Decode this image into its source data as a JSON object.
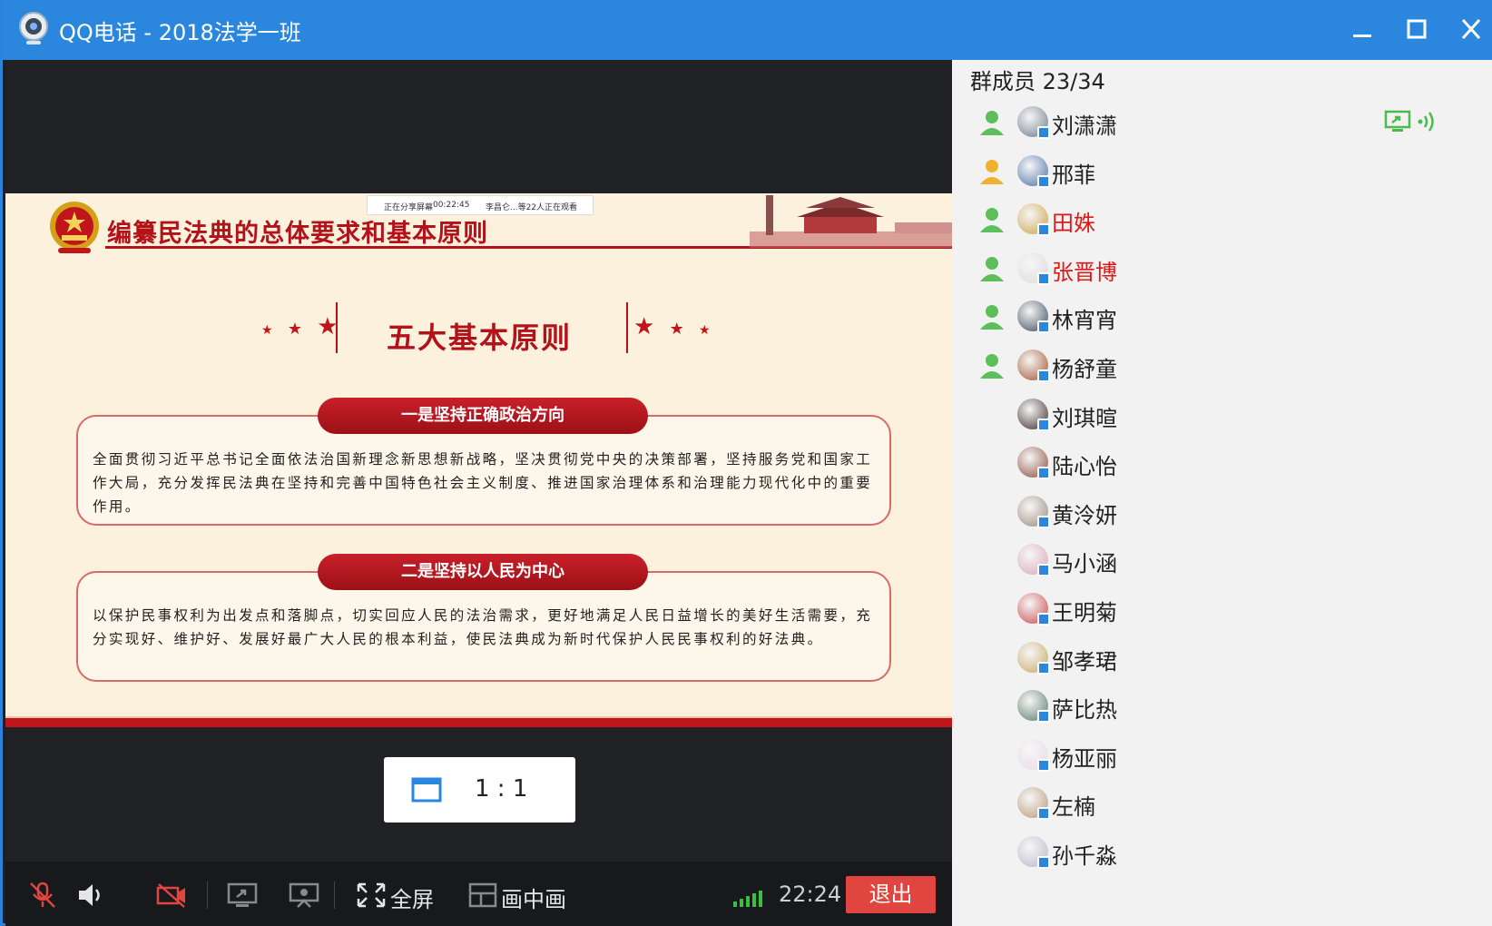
{
  "window": {
    "title": "QQ电话 - 2018法学一班",
    "icons": {
      "app": "qq-webcam-icon",
      "minimize": "minimize-icon",
      "maximize": "maximize-icon",
      "close": "close-icon"
    }
  },
  "share_banner": {
    "status": "正在分享屏幕",
    "timer": "00:22:45",
    "viewers": "李昌仑...等22人正在观看"
  },
  "slide": {
    "header_title": "编纂民法典的总体要求和基本原则",
    "section_title": "五大基本原则",
    "principles": [
      {
        "title": "一是坚持正确政治方向",
        "body": "全面贯彻习近平总书记全面依法治国新理念新思想新战略，坚决贯彻党中央的决策部署，坚持服务党和国家工作大局，充分发挥民法典在坚持和完善中国特色社会主义制度、推进国家治理体系和治理能力现代化中的重要作用。"
      },
      {
        "title": "二是坚持以人民为中心",
        "body": "以保护民事权利为出发点和落脚点，切实回应人民的法治需求，更好地满足人民日益增长的美好生活需要，充分实现好、维护好、发展好最广大人民的根本利益，使民法典成为新时代保护人民民事权利的好法典。"
      }
    ]
  },
  "view_ratio": {
    "label": "1 : 1",
    "icon": "window-icon"
  },
  "toolbar": {
    "mic_icon": "mic-muted-icon",
    "speaker_icon": "speaker-icon",
    "camera_icon": "camera-off-icon",
    "share_screen_icon": "share-screen-icon",
    "present_icon": "present-icon",
    "fullscreen_label": "全屏",
    "fullscreen_icon": "fullscreen-icon",
    "pip_label": "画中画",
    "pip_icon": "picture-in-picture-icon",
    "signal_icon": "signal-icon",
    "time": "22:24",
    "exit_label": "退出",
    "colors": {
      "exit": "#e0453f",
      "signal": "#3cbf3c"
    }
  },
  "members": {
    "header": "群成员 23/34",
    "list": [
      {
        "name": "刘潇潇",
        "in_call": true,
        "highlight": false,
        "sharing": true,
        "speaking": true
      },
      {
        "name": "邢菲",
        "in_call": true,
        "highlight": false,
        "sharing": false,
        "speaking": false
      },
      {
        "name": "田姝",
        "in_call": true,
        "highlight": true,
        "sharing": false,
        "speaking": false
      },
      {
        "name": "张晋博",
        "in_call": true,
        "highlight": true,
        "sharing": false,
        "speaking": false
      },
      {
        "name": "林宵宵",
        "in_call": true,
        "highlight": false,
        "sharing": false,
        "speaking": false
      },
      {
        "name": "杨舒童",
        "in_call": true,
        "highlight": false,
        "sharing": false,
        "speaking": false
      },
      {
        "name": "刘琪暄",
        "in_call": false,
        "highlight": false,
        "sharing": false,
        "speaking": false
      },
      {
        "name": "陆心怡",
        "in_call": false,
        "highlight": false,
        "sharing": false,
        "speaking": false
      },
      {
        "name": "黄泠妍",
        "in_call": false,
        "highlight": false,
        "sharing": false,
        "speaking": false
      },
      {
        "name": "马小涵",
        "in_call": false,
        "highlight": false,
        "sharing": false,
        "speaking": false
      },
      {
        "name": "王明菊",
        "in_call": false,
        "highlight": false,
        "sharing": false,
        "speaking": false
      },
      {
        "name": "邹孝珺",
        "in_call": false,
        "highlight": false,
        "sharing": false,
        "speaking": false
      },
      {
        "name": "萨比热",
        "in_call": false,
        "highlight": false,
        "sharing": false,
        "speaking": false
      },
      {
        "name": "杨亚丽",
        "in_call": false,
        "highlight": false,
        "sharing": false,
        "speaking": false
      },
      {
        "name": "左楠",
        "in_call": false,
        "highlight": false,
        "sharing": false,
        "speaking": false
      },
      {
        "name": "孙千淼",
        "in_call": false,
        "highlight": false,
        "sharing": false,
        "speaking": false
      }
    ],
    "colors": {
      "highlight": "#e01818",
      "status": "#5cbf5c"
    }
  }
}
